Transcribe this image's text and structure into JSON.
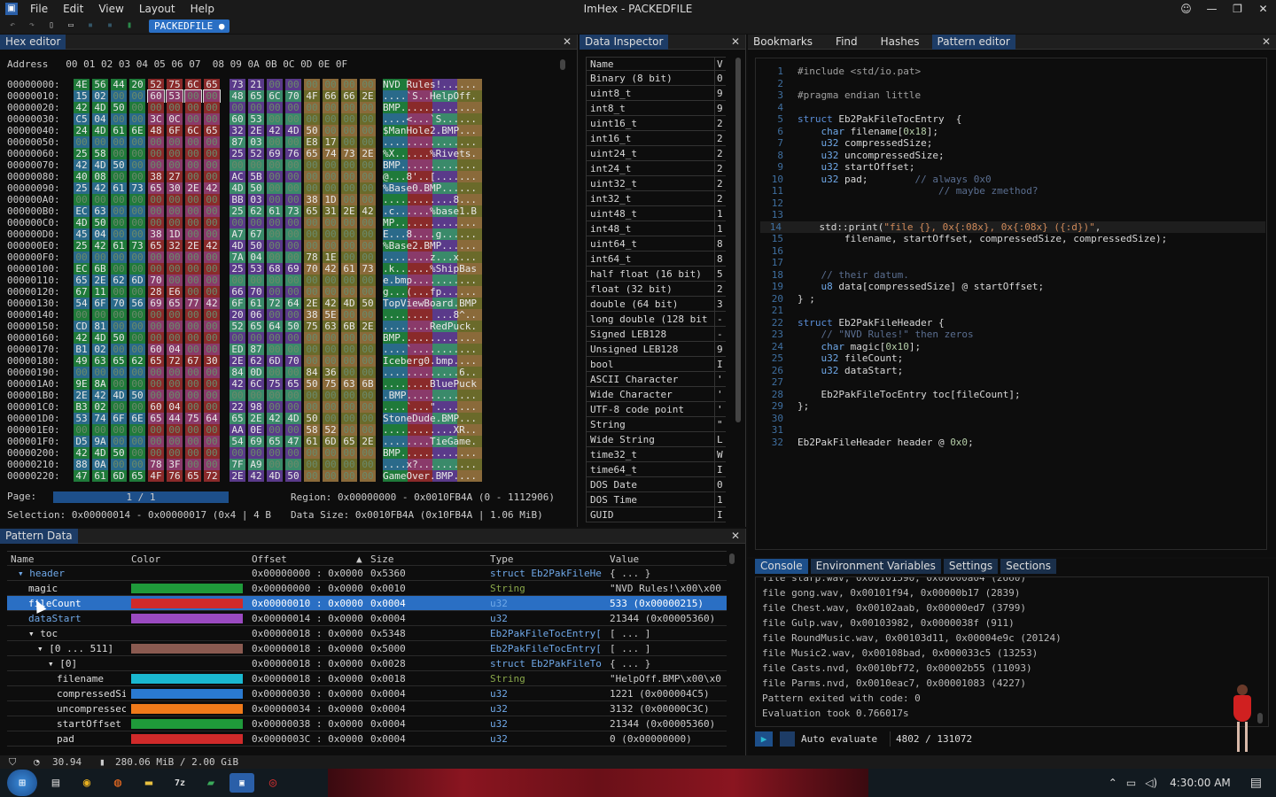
{
  "app": {
    "title": "ImHex - PACKEDFILE",
    "menu": [
      "File",
      "Edit",
      "View",
      "Layout",
      "Help"
    ],
    "file_tab": "PACKEDFILE ●"
  },
  "hex": {
    "tab": "Hex editor",
    "header": "Address   00 01 02 03 04 05 06 07  08 09 0A 0B 0C 0D 0E 0F",
    "rows": [
      {
        "a": "00000000:",
        "b": "4E 56 44 20 52 75 6C 65 73 21 00 00 00 00 00 00",
        "s": "NVD Rules!......"
      },
      {
        "a": "00000010:",
        "b": "15 02 00 00 60 53 00 00 48 65 6C 70 4F 66 66 2E",
        "s": "....`S..HelpOff."
      },
      {
        "a": "00000020:",
        "b": "42 4D 50 00 00 00 00 00 00 00 00 00 00 00 00 00",
        "s": "BMP............."
      },
      {
        "a": "00000030:",
        "b": "C5 04 00 00 3C 0C 00 00 60 53 00 00 00 00 00 00",
        "s": "....<...`S......"
      },
      {
        "a": "00000040:",
        "b": "24 4D 61 6E 48 6F 6C 65 32 2E 42 4D 50 00 00 00",
        "s": "$ManHole2.BMP..."
      },
      {
        "a": "00000050:",
        "b": "00 00 00 00 00 00 00 00 87 03 00 00 E8 17 00 00",
        "s": "................"
      },
      {
        "a": "00000060:",
        "b": "25 58 00 00 00 00 00 00 25 52 69 76 65 74 73 2E",
        "s": "%X......%Rivets."
      },
      {
        "a": "00000070:",
        "b": "42 4D 50 00 00 00 00 00 00 00 00 00 00 00 00 00",
        "s": "BMP............."
      },
      {
        "a": "00000080:",
        "b": "40 08 00 00 38 27 00 00 AC 5B 00 00 00 00 00 00",
        "s": "@...8'..[......."
      },
      {
        "a": "00000090:",
        "b": "25 42 61 73 65 30 2E 42 4D 50 00 00 00 00 00 00",
        "s": "%Base0.BMP......"
      },
      {
        "a": "000000A0:",
        "b": "00 00 00 00 00 00 00 00 BB 03 00 00 38 1D 00 00",
        "s": "............8..."
      },
      {
        "a": "000000B0:",
        "b": "EC 63 00 00 00 00 00 00 25 62 61 73 65 31 2E 42",
        "s": ".c......%base1.B"
      },
      {
        "a": "000000C0:",
        "b": "4D 50 00 00 00 00 00 00 00 00 00 00 00 00 00 00",
        "s": "MP.............."
      },
      {
        "a": "000000D0:",
        "b": "45 04 00 00 38 1D 00 00 A7 67 00 00 00 00 00 00",
        "s": "E...8....g......"
      },
      {
        "a": "000000E0:",
        "b": "25 42 61 73 65 32 2E 42 4D 50 00 00 00 00 00 00",
        "s": "%Base2.BMP......"
      },
      {
        "a": "000000F0:",
        "b": "00 00 00 00 00 00 00 00 7A 04 00 00 78 1E 00 00",
        "s": "........z...x..."
      },
      {
        "a": "00000100:",
        "b": "EC 6B 00 00 00 00 00 00 25 53 68 69 70 42 61 73",
        "s": ".k......%ShipBas"
      },
      {
        "a": "00000110:",
        "b": "65 2E 62 6D 70 00 00 00 00 00 00 00 00 00 00 00",
        "s": "e.bmp..........."
      },
      {
        "a": "00000120:",
        "b": "67 11 00 00 28 E6 00 00 66 70 00 00 00 00 00 00",
        "s": "g...(...fp......"
      },
      {
        "a": "00000130:",
        "b": "54 6F 70 56 69 65 77 42 6F 61 72 64 2E 42 4D 50",
        "s": "TopViewBoard.BMP"
      },
      {
        "a": "00000140:",
        "b": "00 00 00 00 00 00 00 00 20 06 00 00 38 5E 00 00",
        "s": "........ ...8^.."
      },
      {
        "a": "00000150:",
        "b": "CD 81 00 00 00 00 00 00 52 65 64 50 75 63 6B 2E",
        "s": "........RedPuck."
      },
      {
        "a": "00000160:",
        "b": "42 4D 50 00 00 00 00 00 00 00 00 00 00 00 00 00",
        "s": "BMP............."
      },
      {
        "a": "00000170:",
        "b": "B1 02 00 00 60 04 00 00 ED 87 00 00 00 00 00 00",
        "s": "....`..........."
      },
      {
        "a": "00000180:",
        "b": "49 63 65 62 65 72 67 30 2E 62 6D 70 00 00 00 00",
        "s": "Iceberg0.bmp...."
      },
      {
        "a": "00000190:",
        "b": "00 00 00 00 00 00 00 00 84 0D 00 00 84 36 00 00",
        "s": ".............6.."
      },
      {
        "a": "000001A0:",
        "b": "9E 8A 00 00 00 00 00 00 42 6C 75 65 50 75 63 6B",
        "s": "........BluePuck"
      },
      {
        "a": "000001B0:",
        "b": "2E 42 4D 50 00 00 00 00 00 00 00 00 00 00 00 00",
        "s": ".BMP............"
      },
      {
        "a": "000001C0:",
        "b": "B3 02 00 00 60 04 00 00 22 98 00 00 00 00 00 00",
        "s": "....`...\"......."
      },
      {
        "a": "000001D0:",
        "b": "53 74 6F 6E 65 44 75 64 65 2E 42 4D 50 00 00 00",
        "s": "StoneDude.BMP..."
      },
      {
        "a": "000001E0:",
        "b": "00 00 00 00 00 00 00 00 AA 0E 00 00 58 52 00 00",
        "s": "............XR.."
      },
      {
        "a": "000001F0:",
        "b": "D5 9A 00 00 00 00 00 00 54 69 65 47 61 6D 65 2E",
        "s": "........TieGame."
      },
      {
        "a": "00000200:",
        "b": "42 4D 50 00 00 00 00 00 00 00 00 00 00 00 00 00",
        "s": "BMP............."
      },
      {
        "a": "00000210:",
        "b": "88 0A 00 00 78 3F 00 00 7F A9 00 00 00 00 00 00",
        "s": "....x?.........."
      },
      {
        "a": "00000220:",
        "b": "47 61 6D 65 4F 76 65 72 2E 42 4D 50 00 00 00 00",
        "s": "GameOver.BMP...."
      }
    ],
    "page_label": "Page:",
    "page_value": "1 / 1",
    "region": "Region: 0x00000000 - 0x0010FB4A (0 - 1112906)",
    "selection": "Selection: 0x00000014 - 0x00000017 (0x4 | 4 B",
    "datasize": "Data Size: 0x0010FB4A (0x10FB4A | 1.06 MiB)",
    "colors": [
      "#1f7a3a",
      "#8a2a2a",
      "#5a3a8a",
      "#8a6a3a",
      "#2a6a8a",
      "#8a3a6a",
      "#3a8a6a",
      "#6a6a2a"
    ]
  },
  "inspector": {
    "tab": "Data Inspector",
    "col_name": "Name",
    "col_value": "V",
    "rows": [
      [
        "Binary (8 bit)",
        "0"
      ],
      [
        "uint8_t",
        "9"
      ],
      [
        "int8_t",
        "9"
      ],
      [
        "uint16_t",
        "2"
      ],
      [
        "int16_t",
        "2"
      ],
      [
        "uint24_t",
        "2"
      ],
      [
        "int24_t",
        "2"
      ],
      [
        "uint32_t",
        "2"
      ],
      [
        "int32_t",
        "2"
      ],
      [
        "uint48_t",
        "1"
      ],
      [
        "int48_t",
        "1"
      ],
      [
        "uint64_t",
        "8"
      ],
      [
        "int64_t",
        "8"
      ],
      [
        "half float (16 bit)",
        "5"
      ],
      [
        "float (32 bit)",
        "2"
      ],
      [
        "double (64 bit)",
        "3"
      ],
      [
        "long double (128 bit",
        "-"
      ],
      [
        "Signed LEB128",
        "-"
      ],
      [
        "Unsigned LEB128",
        "9"
      ],
      [
        "bool",
        "I"
      ],
      [
        "ASCII Character",
        "'"
      ],
      [
        "Wide Character",
        "'"
      ],
      [
        "UTF-8 code point",
        "'"
      ],
      [
        "String",
        "\""
      ],
      [
        "Wide String",
        "L"
      ],
      [
        "time32_t",
        "W"
      ],
      [
        "time64_t",
        "I"
      ],
      [
        "DOS Date",
        "0"
      ],
      [
        "DOS Time",
        "1"
      ],
      [
        "GUID",
        "I"
      ]
    ]
  },
  "editor": {
    "tabs": [
      "Bookmarks",
      "Find",
      "Hashes",
      "Pattern editor"
    ],
    "lines": [
      [
        {
          "c": "pp",
          "t": "#include <std/io.pat>"
        }
      ],
      [],
      [
        {
          "c": "pp",
          "t": "#pragma endian little"
        }
      ],
      [],
      [
        {
          "c": "kw",
          "t": "struct "
        },
        {
          "c": "",
          "t": "Eb2PakFileTocEntry  {"
        }
      ],
      [
        {
          "c": "",
          "t": "    "
        },
        {
          "c": "ty",
          "t": "char "
        },
        {
          "c": "",
          "t": "filename["
        },
        {
          "c": "num",
          "t": "0x18"
        },
        {
          "c": "",
          "t": "];"
        }
      ],
      [
        {
          "c": "",
          "t": "    "
        },
        {
          "c": "ty",
          "t": "u32 "
        },
        {
          "c": "",
          "t": "compressedSize;"
        }
      ],
      [
        {
          "c": "",
          "t": "    "
        },
        {
          "c": "ty",
          "t": "u32 "
        },
        {
          "c": "",
          "t": "uncompressedSize;"
        }
      ],
      [
        {
          "c": "",
          "t": "    "
        },
        {
          "c": "ty",
          "t": "u32 "
        },
        {
          "c": "",
          "t": "startOffset;"
        }
      ],
      [
        {
          "c": "",
          "t": "    "
        },
        {
          "c": "ty",
          "t": "u32 "
        },
        {
          "c": "",
          "t": "pad;        "
        },
        {
          "c": "cm",
          "t": "// always 0x0"
        }
      ],
      [
        {
          "c": "cm",
          "t": "                        // maybe zmethod?"
        }
      ],
      [],
      [],
      [
        {
          "c": "",
          "t": "    std::print("
        },
        {
          "c": "str",
          "t": "\"file {}, 0x{:08x}, 0x{:08x} ({:d})\""
        },
        {
          "c": "",
          "t": ","
        }
      ],
      [
        {
          "c": "",
          "t": "        filename, startOffset, compressedSize, compressedSize);"
        }
      ],
      [],
      [],
      [
        {
          "c": "cm",
          "t": "    // their datum."
        }
      ],
      [
        {
          "c": "",
          "t": "    "
        },
        {
          "c": "ty",
          "t": "u8 "
        },
        {
          "c": "",
          "t": "data[compressedSize] @ startOffset;"
        }
      ],
      [
        {
          "c": "",
          "t": "} ;"
        }
      ],
      [],
      [
        {
          "c": "kw",
          "t": "struct "
        },
        {
          "c": "",
          "t": "Eb2PakFileHeader {"
        }
      ],
      [
        {
          "c": "cm",
          "t": "    // \"NVD Rules!\" then zeros"
        }
      ],
      [
        {
          "c": "",
          "t": "    "
        },
        {
          "c": "ty",
          "t": "char "
        },
        {
          "c": "",
          "t": "magic["
        },
        {
          "c": "num",
          "t": "0x10"
        },
        {
          "c": "",
          "t": "];"
        }
      ],
      [
        {
          "c": "",
          "t": "    "
        },
        {
          "c": "ty",
          "t": "u32 "
        },
        {
          "c": "",
          "t": "fileCount;"
        }
      ],
      [
        {
          "c": "",
          "t": "    "
        },
        {
          "c": "ty",
          "t": "u32 "
        },
        {
          "c": "",
          "t": "dataStart;"
        }
      ],
      [],
      [
        {
          "c": "",
          "t": "    Eb2PakFileTocEntry toc[fileCount];"
        }
      ],
      [
        {
          "c": "",
          "t": "};"
        }
      ],
      [],
      [],
      [
        {
          "c": "",
          "t": "Eb2PakFileHeader header @ "
        },
        {
          "c": "num",
          "t": "0x0"
        },
        {
          "c": "",
          "t": ";"
        }
      ]
    ]
  },
  "pattern": {
    "tab": "Pattern Data",
    "cols": [
      "Name",
      "Color",
      "Offset",
      "Size",
      "Type",
      "Value"
    ],
    "rows": [
      {
        "name": "▾ header",
        "indent": 8,
        "color": "",
        "offset": "0x00000000 : 0x0000",
        "size": "0x5360",
        "type": "struct Eb2PakFileHe",
        "value": "{ ... }",
        "nc": "#6fa8e8",
        "tc": "#6fa8e8"
      },
      {
        "name": "magic",
        "indent": 20,
        "color": "#1f9a3a",
        "offset": "0x00000000 : 0x0000",
        "size": "0x0010",
        "type": "String",
        "value": "\"NVD Rules!\\x00\\x00",
        "nc": "#ddd",
        "tc": "#8aa84a"
      },
      {
        "name": "fileCount",
        "indent": 20,
        "color": "#d02a2a",
        "offset": "0x00000010 : 0x0000",
        "size": "0x0004",
        "type": "u32",
        "value": "533 (0x00000215)",
        "nc": "#fff",
        "tc": "#6fa8e8",
        "sel": true
      },
      {
        "name": "dataStart",
        "indent": 20,
        "color": "#9a4ac0",
        "offset": "0x00000014 : 0x0000",
        "size": "0x0004",
        "type": "u32",
        "value": "21344 (0x00005360)",
        "nc": "#6fa8e8",
        "tc": "#6fa8e8"
      },
      {
        "name": "▾ toc",
        "indent": 20,
        "color": "",
        "offset": "0x00000018 : 0x0000",
        "size": "0x5348",
        "type": "Eb2PakFileTocEntry[",
        "value": "[ ... ]",
        "nc": "#ddd",
        "tc": "#6fa8e8"
      },
      {
        "name": "▾ [0 ... 511]",
        "indent": 30,
        "color": "#8a5a50",
        "offset": "0x00000018 : 0x0000",
        "size": "0x5000",
        "type": "Eb2PakFileTocEntry[",
        "value": "[ ... ]",
        "nc": "#ddd",
        "tc": "#6fa8e8"
      },
      {
        "name": "▾ [0]",
        "indent": 42,
        "color": "",
        "offset": "0x00000018 : 0x0000",
        "size": "0x0028",
        "type": "struct Eb2PakFileTo",
        "value": "{ ... }",
        "nc": "#ddd",
        "tc": "#6fa8e8"
      },
      {
        "name": "filename",
        "indent": 52,
        "color": "#1ab8d0",
        "offset": "0x00000018 : 0x0000",
        "size": "0x0018",
        "type": "String",
        "value": "\"HelpOff.BMP\\x00\\x0",
        "nc": "#ddd",
        "tc": "#8aa84a"
      },
      {
        "name": "compressedSi",
        "indent": 52,
        "color": "#2a7ad0",
        "offset": "0x00000030 : 0x0000",
        "size": "0x0004",
        "type": "u32",
        "value": "1221 (0x000004C5)",
        "nc": "#ddd",
        "tc": "#6fa8e8"
      },
      {
        "name": "uncompressec",
        "indent": 52,
        "color": "#f07a1a",
        "offset": "0x00000034 : 0x0000",
        "size": "0x0004",
        "type": "u32",
        "value": "3132 (0x00000C3C)",
        "nc": "#ddd",
        "tc": "#6fa8e8"
      },
      {
        "name": "startOffset",
        "indent": 52,
        "color": "#1f9a3a",
        "offset": "0x00000038 : 0x0000",
        "size": "0x0004",
        "type": "u32",
        "value": "21344 (0x00005360)",
        "nc": "#ddd",
        "tc": "#6fa8e8"
      },
      {
        "name": "pad",
        "indent": 52,
        "color": "#d02a2a",
        "offset": "0x0000003C : 0x0000",
        "size": "0x0004",
        "type": "u32",
        "value": "0 (0x00000000)",
        "nc": "#ddd",
        "tc": "#6fa8e8"
      }
    ]
  },
  "console": {
    "tabs": [
      "Console",
      "Environment Variables",
      "Settings",
      "Sections"
    ],
    "lines": [
      "file starp.wav, 0x00101590, 0x00000a04 (2660)",
      "file gong.wav, 0x00101f94, 0x00000b17 (2839)",
      "file Chest.wav, 0x00102aab, 0x00000ed7 (3799)",
      "file Gulp.wav, 0x00103982, 0x0000038f (911)",
      "file RoundMusic.wav, 0x00103d11, 0x00004e9c (20124)",
      "file Music2.wav, 0x00108bad, 0x000033c5 (13253)",
      "file Casts.nvd, 0x0010bf72, 0x00002b55 (11093)",
      "file Parms.nvd, 0x0010eac7, 0x00001083 (4227)",
      "Pattern exited with code: 0",
      "Evaluation took 0.766017s"
    ],
    "auto_evaluate": "Auto evaluate",
    "count": "4802 / 131072"
  },
  "status": {
    "fps": "30.94",
    "memory": "280.06 MiB / 2.00 GiB"
  },
  "taskbar": {
    "time": "4:30:00 AM"
  }
}
